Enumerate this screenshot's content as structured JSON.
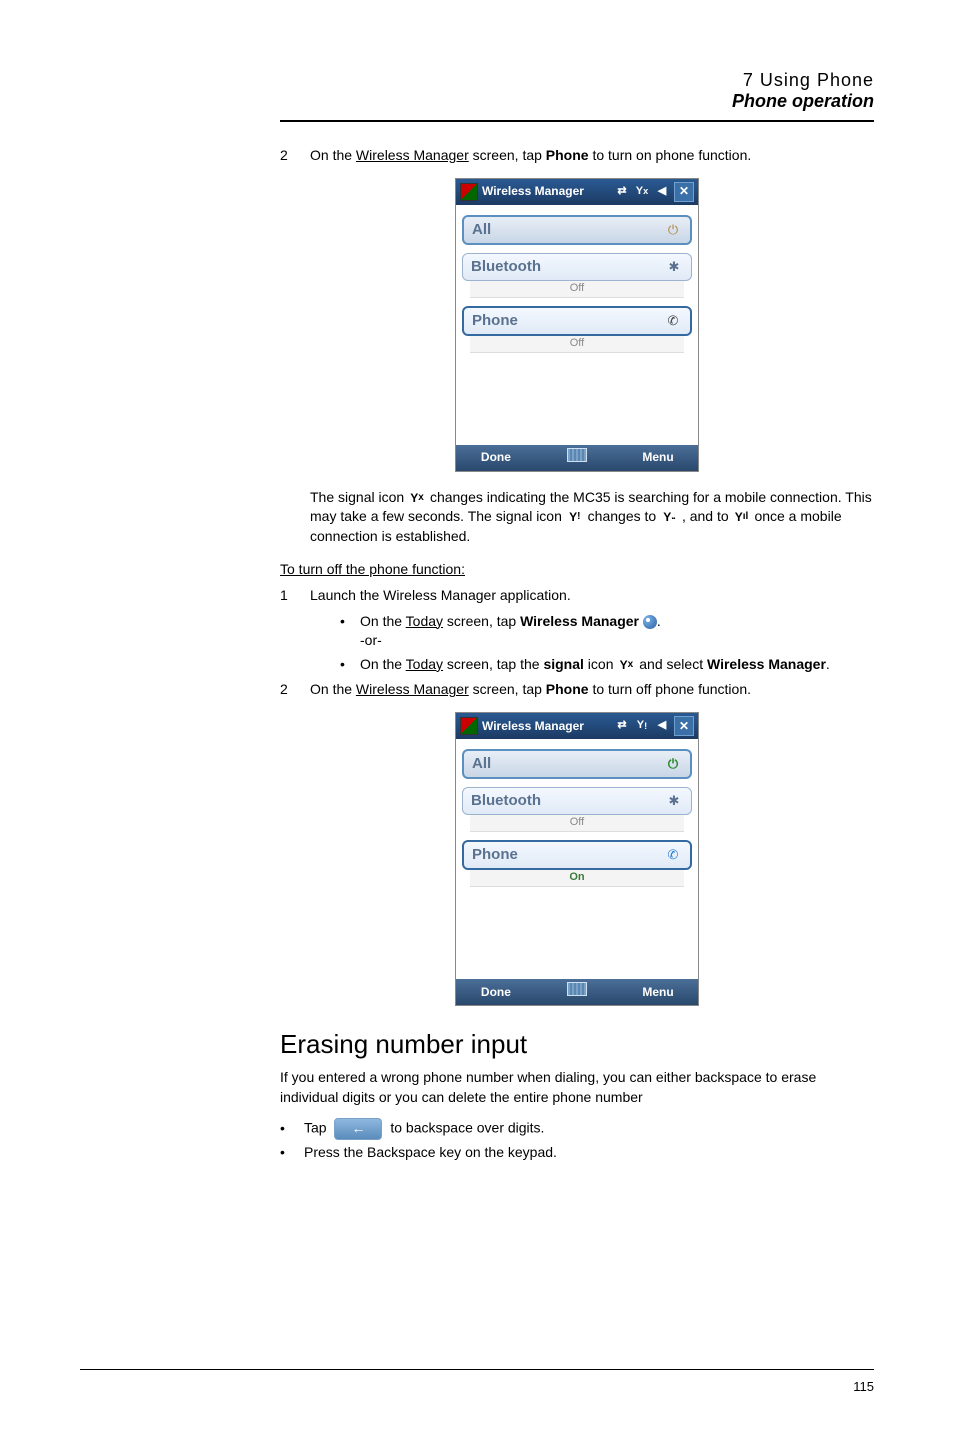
{
  "header": {
    "line1": "7 Using Phone",
    "line2": "Phone operation"
  },
  "step2a": {
    "num": "2",
    "pre": "On the ",
    "link": "Wireless Manager",
    "mid": " screen, tap ",
    "bold": "Phone",
    "post": " to turn on phone function."
  },
  "wm": {
    "title": "Wireless Manager",
    "all": "All",
    "bluetooth": "Bluetooth",
    "phone": "Phone",
    "off": "Off",
    "on": "On",
    "done": "Done",
    "menu": "Menu"
  },
  "signal_para": {
    "t1": "The signal icon ",
    "t2": " changes indicating the MC35 is searching for a mobile connection. This may take a few seconds. The signal icon ",
    "t3": " changes to ",
    "t4": " , and to ",
    "t5": " once a mobile connection is established."
  },
  "turnoff_heading": "To turn off the phone function:",
  "step1b": {
    "num": "1",
    "txt": "Launch the Wireless Manager application."
  },
  "sub1": {
    "pre": "On the ",
    "link": "Today",
    "mid": " screen, tap ",
    "bold": "Wireless Manager",
    "dot": "."
  },
  "or": "-or-",
  "sub2": {
    "pre": "On the ",
    "link": "Today",
    "mid": " screen, tap the ",
    "bold1": "signal",
    "mid2": " icon ",
    "mid3": " and select ",
    "bold2": "Wireless Manager",
    "dot": "."
  },
  "step2b": {
    "num": "2",
    "pre": "On the ",
    "link": "Wireless Manager",
    "mid": " screen, tap ",
    "bold": "Phone",
    "post": " to turn off phone function."
  },
  "erase": {
    "title": "Erasing number input",
    "para": "If you entered a wrong phone number when dialing, you can either backspace to erase individual digits or you can delete the entire phone number",
    "b1a": "Tap ",
    "b1b": " to backspace over digits.",
    "b2": "Press the Backspace key on the keypad."
  },
  "pagenum": "115"
}
